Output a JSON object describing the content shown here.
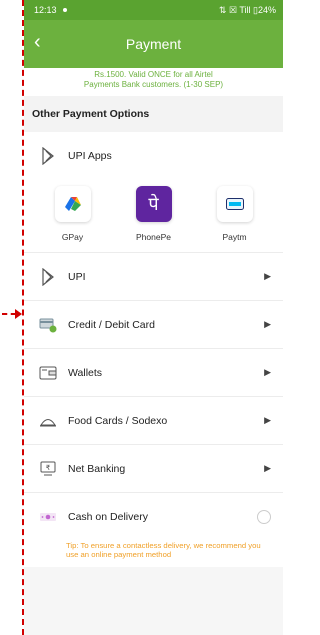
{
  "status": {
    "time": "12:13",
    "right": "⇅ ☒ Till ▯24%"
  },
  "appbar": {
    "title": "Payment"
  },
  "note": {
    "line1": "Rs.1500. Valid ONCE for all Airtel",
    "line2": "Payments Bank customers. (1-30 SEP)"
  },
  "section": {
    "other_payment": "Other Payment Options"
  },
  "upi_apps": {
    "label": "UPI Apps",
    "items": [
      {
        "label": "GPay"
      },
      {
        "label": "PhonePe"
      },
      {
        "label": "Paytm"
      }
    ]
  },
  "rows": {
    "upi": "UPI",
    "card": "Credit / Debit Card",
    "wallets": "Wallets",
    "food": "Food Cards / Sodexo",
    "netbanking": "Net Banking",
    "cod": "Cash on Delivery"
  },
  "tip": "Tip: To ensure a contactless delivery, we recommend you use an online payment method",
  "colors": {
    "accent": "#6cb13e",
    "annotation": "#d10000",
    "tip": "#f0a028"
  }
}
